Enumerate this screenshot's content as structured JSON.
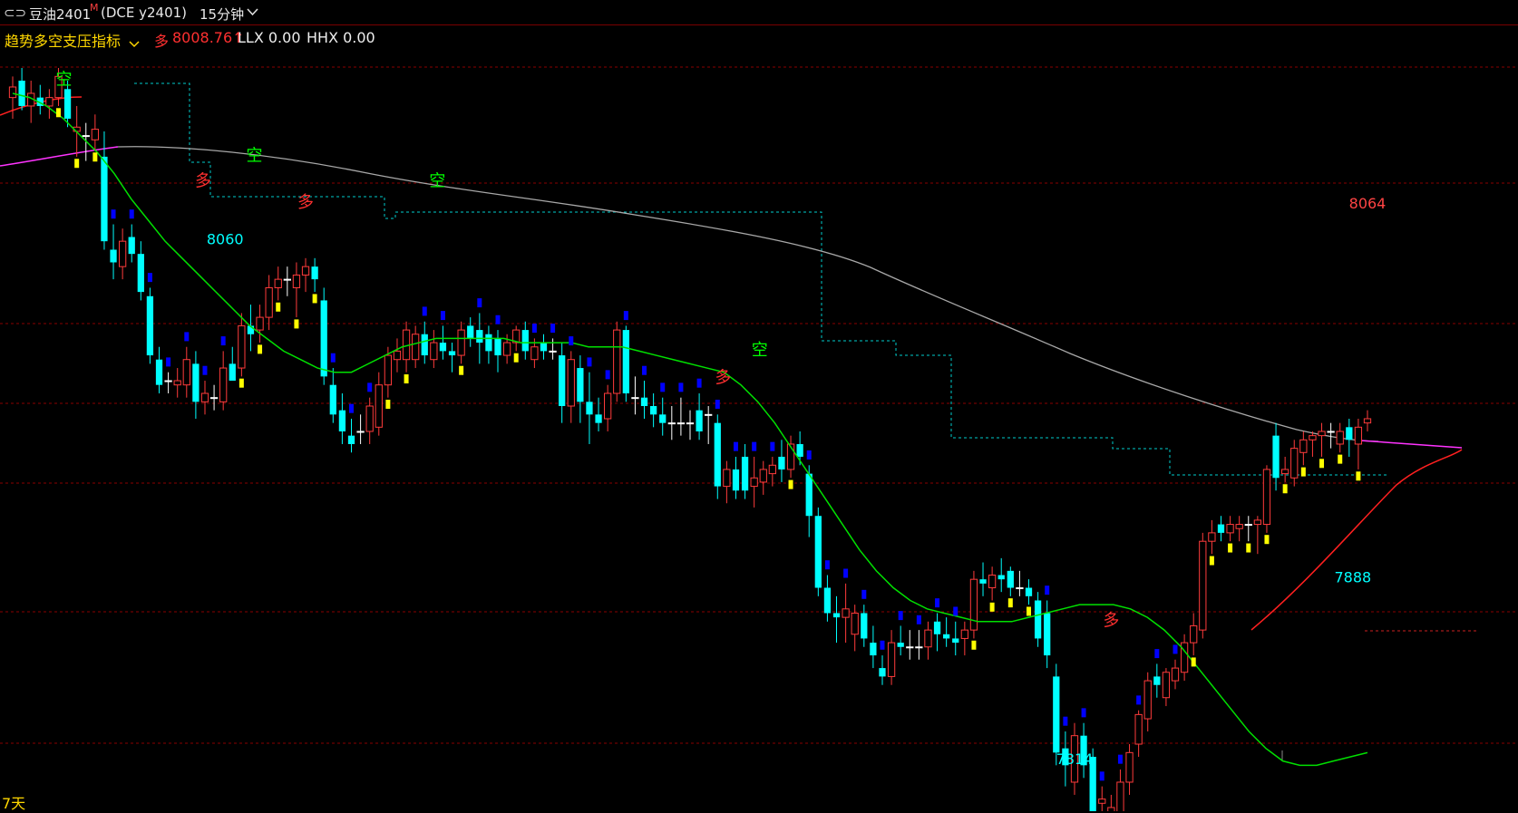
{
  "header": {
    "link_icon": "link-icon",
    "symbol": "豆油2401",
    "sup": "M",
    "code": "(DCE y2401)",
    "period": "15分钟",
    "dropdown_icon": "chevron-down-icon"
  },
  "indicator": {
    "name": "趋势多空支压指标",
    "dropdown_icon": "chevron-down-icon",
    "dir_label": "多",
    "value": "8008.76↑",
    "llx": "LLX 0.00",
    "hhx": "HHX 0.00"
  },
  "bottom_label": "7天",
  "colors": {
    "up": "#ff3b3b",
    "down": "#00ffff",
    "ma_fast": "#00e000",
    "ma_long": "#a8a8a8",
    "ma_magenta": "#ff33ff",
    "support_down": "#0000ff",
    "support_up": "#ffff00",
    "grid": "#8a0000",
    "resistance": "#00cccc"
  },
  "chart_data": {
    "type": "candlestick",
    "ylim": [
      7808,
      8134
    ],
    "annotations": [
      {
        "text": "8060",
        "x": 29,
        "y": 8060,
        "color": "#00ffff",
        "pos": "below"
      },
      {
        "text": "7814",
        "x": 145,
        "y": 7814,
        "color": "#00ffff",
        "pos": "below"
      },
      {
        "text": "8064",
        "x": 185,
        "y": 8064,
        "color": "#ff4444",
        "pos": "above"
      },
      {
        "text": "7888",
        "x": 183,
        "y": 7888,
        "color": "#00ffff",
        "pos": "level"
      }
    ],
    "signals": [
      {
        "text": "空",
        "x": 7,
        "y": 8126,
        "color": "#00ff00"
      },
      {
        "text": "多",
        "x": 26,
        "y": 8078,
        "color": "#ff3030"
      },
      {
        "text": "空",
        "x": 33,
        "y": 8090,
        "color": "#00ff00"
      },
      {
        "text": "多",
        "x": 40,
        "y": 8068,
        "color": "#ff3030"
      },
      {
        "text": "空",
        "x": 58,
        "y": 8078,
        "color": "#00ff00"
      },
      {
        "text": "多",
        "x": 97,
        "y": 7985,
        "color": "#ff3030"
      },
      {
        "text": "空",
        "x": 102,
        "y": 7998,
        "color": "#00ff00"
      },
      {
        "text": "多",
        "x": 150,
        "y": 7870,
        "color": "#ff3030"
      }
    ],
    "candles": [
      {
        "o": 8120,
        "h": 8130,
        "l": 8110,
        "c": 8125
      },
      {
        "o": 8128,
        "h": 8134,
        "l": 8114,
        "c": 8116
      },
      {
        "o": 8116,
        "h": 8128,
        "l": 8108,
        "c": 8122
      },
      {
        "o": 8120,
        "h": 8126,
        "l": 8112,
        "c": 8116
      },
      {
        "o": 8116,
        "h": 8124,
        "l": 8110,
        "c": 8120
      },
      {
        "o": 8120,
        "h": 8134,
        "l": 8116,
        "c": 8130
      },
      {
        "o": 8124,
        "h": 8128,
        "l": 8106,
        "c": 8110
      },
      {
        "o": 8104,
        "h": 8116,
        "l": 8092,
        "c": 8106
      },
      {
        "o": 8102,
        "h": 8108,
        "l": 8090,
        "c": 8102
      },
      {
        "o": 8100,
        "h": 8112,
        "l": 8095,
        "c": 8105
      },
      {
        "o": 8092,
        "h": 8104,
        "l": 8048,
        "c": 8052
      },
      {
        "o": 8048,
        "h": 8060,
        "l": 8034,
        "c": 8042
      },
      {
        "o": 8040,
        "h": 8058,
        "l": 8034,
        "c": 8052
      },
      {
        "o": 8054,
        "h": 8060,
        "l": 8042,
        "c": 8046
      },
      {
        "o": 8046,
        "h": 8052,
        "l": 8024,
        "c": 8028
      },
      {
        "o": 8026,
        "h": 8030,
        "l": 7994,
        "c": 7998
      },
      {
        "o": 7996,
        "h": 8002,
        "l": 7980,
        "c": 7984
      },
      {
        "o": 7986,
        "h": 7990,
        "l": 7980,
        "c": 7986
      },
      {
        "o": 7984,
        "h": 7992,
        "l": 7978,
        "c": 7986
      },
      {
        "o": 7984,
        "h": 8002,
        "l": 7978,
        "c": 7996
      },
      {
        "o": 7994,
        "h": 8000,
        "l": 7968,
        "c": 7976
      },
      {
        "o": 7976,
        "h": 7986,
        "l": 7970,
        "c": 7980
      },
      {
        "o": 7978,
        "h": 7984,
        "l": 7972,
        "c": 7978
      },
      {
        "o": 7976,
        "h": 8000,
        "l": 7972,
        "c": 7992
      },
      {
        "o": 7994,
        "h": 8002,
        "l": 7986,
        "c": 7986
      },
      {
        "o": 7992,
        "h": 8018,
        "l": 7988,
        "c": 8012
      },
      {
        "o": 8012,
        "h": 8022,
        "l": 8000,
        "c": 8008
      },
      {
        "o": 8010,
        "h": 8022,
        "l": 8004,
        "c": 8016
      },
      {
        "o": 8016,
        "h": 8036,
        "l": 8010,
        "c": 8030
      },
      {
        "o": 8030,
        "h": 8040,
        "l": 8024,
        "c": 8034
      },
      {
        "o": 8034,
        "h": 8040,
        "l": 8026,
        "c": 8034
      },
      {
        "o": 8030,
        "h": 8042,
        "l": 8016,
        "c": 8036
      },
      {
        "o": 8036,
        "h": 8044,
        "l": 8028,
        "c": 8040
      },
      {
        "o": 8040,
        "h": 8044,
        "l": 8028,
        "c": 8034
      },
      {
        "o": 8024,
        "h": 8030,
        "l": 7984,
        "c": 7988
      },
      {
        "o": 7984,
        "h": 7992,
        "l": 7966,
        "c": 7970
      },
      {
        "o": 7972,
        "h": 7980,
        "l": 7956,
        "c": 7962
      },
      {
        "o": 7960,
        "h": 7968,
        "l": 7952,
        "c": 7956
      },
      {
        "o": 7962,
        "h": 7970,
        "l": 7956,
        "c": 7962
      },
      {
        "o": 7962,
        "h": 7978,
        "l": 7956,
        "c": 7974
      },
      {
        "o": 7964,
        "h": 7990,
        "l": 7960,
        "c": 7984
      },
      {
        "o": 7984,
        "h": 8002,
        "l": 7978,
        "c": 7998
      },
      {
        "o": 7996,
        "h": 8006,
        "l": 7990,
        "c": 8000
      },
      {
        "o": 7996,
        "h": 8014,
        "l": 7990,
        "c": 8010
      },
      {
        "o": 7996,
        "h": 8012,
        "l": 7992,
        "c": 8008
      },
      {
        "o": 8008,
        "h": 8014,
        "l": 7994,
        "c": 7998
      },
      {
        "o": 7996,
        "h": 8010,
        "l": 7992,
        "c": 8004
      },
      {
        "o": 8004,
        "h": 8012,
        "l": 7996,
        "c": 8000
      },
      {
        "o": 8000,
        "h": 8004,
        "l": 7990,
        "c": 7998
      },
      {
        "o": 7998,
        "h": 8014,
        "l": 7994,
        "c": 8010
      },
      {
        "o": 8012,
        "h": 8016,
        "l": 8002,
        "c": 8006
      },
      {
        "o": 8010,
        "h": 8018,
        "l": 7994,
        "c": 8004
      },
      {
        "o": 8008,
        "h": 8012,
        "l": 7994,
        "c": 8000
      },
      {
        "o": 8006,
        "h": 8010,
        "l": 7990,
        "c": 7998
      },
      {
        "o": 7998,
        "h": 8008,
        "l": 7994,
        "c": 8004
      },
      {
        "o": 8004,
        "h": 8012,
        "l": 8000,
        "c": 8010
      },
      {
        "o": 8010,
        "h": 8014,
        "l": 7996,
        "c": 8000
      },
      {
        "o": 7996,
        "h": 8006,
        "l": 7992,
        "c": 8002
      },
      {
        "o": 8004,
        "h": 8008,
        "l": 7996,
        "c": 8000
      },
      {
        "o": 8000,
        "h": 8006,
        "l": 7996,
        "c": 8000
      },
      {
        "o": 7998,
        "h": 8004,
        "l": 7966,
        "c": 7974
      },
      {
        "o": 7974,
        "h": 8000,
        "l": 7966,
        "c": 7996
      },
      {
        "o": 7992,
        "h": 7998,
        "l": 7966,
        "c": 7976
      },
      {
        "o": 7976,
        "h": 7990,
        "l": 7956,
        "c": 7970
      },
      {
        "o": 7970,
        "h": 7978,
        "l": 7962,
        "c": 7966
      },
      {
        "o": 7968,
        "h": 7984,
        "l": 7962,
        "c": 7980
      },
      {
        "o": 7980,
        "h": 8014,
        "l": 7976,
        "c": 8010
      },
      {
        "o": 8010,
        "h": 8012,
        "l": 7976,
        "c": 7980
      },
      {
        "o": 7978,
        "h": 7988,
        "l": 7970,
        "c": 7978
      },
      {
        "o": 7978,
        "h": 7986,
        "l": 7968,
        "c": 7974
      },
      {
        "o": 7974,
        "h": 7980,
        "l": 7964,
        "c": 7970
      },
      {
        "o": 7970,
        "h": 7978,
        "l": 7960,
        "c": 7966
      },
      {
        "o": 7966,
        "h": 7974,
        "l": 7958,
        "c": 7966
      },
      {
        "o": 7966,
        "h": 7978,
        "l": 7960,
        "c": 7966
      },
      {
        "o": 7966,
        "h": 7972,
        "l": 7958,
        "c": 7966
      },
      {
        "o": 7972,
        "h": 7980,
        "l": 7958,
        "c": 7962
      },
      {
        "o": 7970,
        "h": 7974,
        "l": 7956,
        "c": 7970
      },
      {
        "o": 7966,
        "h": 7970,
        "l": 7930,
        "c": 7936
      },
      {
        "o": 7936,
        "h": 7948,
        "l": 7928,
        "c": 7944
      },
      {
        "o": 7944,
        "h": 7950,
        "l": 7930,
        "c": 7934
      },
      {
        "o": 7950,
        "h": 7956,
        "l": 7930,
        "c": 7934
      },
      {
        "o": 7936,
        "h": 7950,
        "l": 7926,
        "c": 7940
      },
      {
        "o": 7938,
        "h": 7948,
        "l": 7932,
        "c": 7944
      },
      {
        "o": 7942,
        "h": 7950,
        "l": 7936,
        "c": 7946
      },
      {
        "o": 7950,
        "h": 7958,
        "l": 7938,
        "c": 7944
      },
      {
        "o": 7944,
        "h": 7960,
        "l": 7940,
        "c": 7956
      },
      {
        "o": 7956,
        "h": 7962,
        "l": 7946,
        "c": 7950
      },
      {
        "o": 7942,
        "h": 7946,
        "l": 7912,
        "c": 7922
      },
      {
        "o": 7922,
        "h": 7926,
        "l": 7884,
        "c": 7888
      },
      {
        "o": 7888,
        "h": 7894,
        "l": 7872,
        "c": 7876
      },
      {
        "o": 7876,
        "h": 7884,
        "l": 7862,
        "c": 7874
      },
      {
        "o": 7874,
        "h": 7890,
        "l": 7862,
        "c": 7878
      },
      {
        "o": 7866,
        "h": 7880,
        "l": 7858,
        "c": 7876
      },
      {
        "o": 7876,
        "h": 7880,
        "l": 7860,
        "c": 7864
      },
      {
        "o": 7862,
        "h": 7870,
        "l": 7850,
        "c": 7856
      },
      {
        "o": 7850,
        "h": 7856,
        "l": 7842,
        "c": 7846
      },
      {
        "o": 7846,
        "h": 7868,
        "l": 7842,
        "c": 7862
      },
      {
        "o": 7862,
        "h": 7870,
        "l": 7856,
        "c": 7860
      },
      {
        "o": 7860,
        "h": 7868,
        "l": 7854,
        "c": 7860
      },
      {
        "o": 7860,
        "h": 7868,
        "l": 7854,
        "c": 7860
      },
      {
        "o": 7860,
        "h": 7872,
        "l": 7854,
        "c": 7868
      },
      {
        "o": 7872,
        "h": 7876,
        "l": 7858,
        "c": 7866
      },
      {
        "o": 7866,
        "h": 7874,
        "l": 7860,
        "c": 7864
      },
      {
        "o": 7864,
        "h": 7872,
        "l": 7856,
        "c": 7862
      },
      {
        "o": 7864,
        "h": 7872,
        "l": 7856,
        "c": 7868
      },
      {
        "o": 7868,
        "h": 7896,
        "l": 7864,
        "c": 7892
      },
      {
        "o": 7892,
        "h": 7900,
        "l": 7884,
        "c": 7890
      },
      {
        "o": 7888,
        "h": 7898,
        "l": 7882,
        "c": 7894
      },
      {
        "o": 7894,
        "h": 7902,
        "l": 7886,
        "c": 7892
      },
      {
        "o": 7896,
        "h": 7898,
        "l": 7884,
        "c": 7888
      },
      {
        "o": 7888,
        "h": 7896,
        "l": 7884,
        "c": 7888
      },
      {
        "o": 7888,
        "h": 7892,
        "l": 7880,
        "c": 7884
      },
      {
        "o": 7882,
        "h": 7886,
        "l": 7860,
        "c": 7864
      },
      {
        "o": 7876,
        "h": 7882,
        "l": 7850,
        "c": 7856
      },
      {
        "o": 7846,
        "h": 7852,
        "l": 7804,
        "c": 7810
      },
      {
        "o": 7812,
        "h": 7820,
        "l": 7794,
        "c": 7804
      },
      {
        "o": 7796,
        "h": 7824,
        "l": 7790,
        "c": 7818
      },
      {
        "o": 7818,
        "h": 7824,
        "l": 7798,
        "c": 7804
      },
      {
        "o": 7808,
        "h": 7812,
        "l": 7774,
        "c": 7780
      },
      {
        "o": 7786,
        "h": 7794,
        "l": 7778,
        "c": 7788
      },
      {
        "o": 7782,
        "h": 7790,
        "l": 7770,
        "c": 7784
      },
      {
        "o": 7782,
        "h": 7802,
        "l": 7778,
        "c": 7796
      },
      {
        "o": 7796,
        "h": 7814,
        "l": 7790,
        "c": 7810
      },
      {
        "o": 7814,
        "h": 7830,
        "l": 7808,
        "c": 7828
      },
      {
        "o": 7826,
        "h": 7848,
        "l": 7820,
        "c": 7844
      },
      {
        "o": 7846,
        "h": 7852,
        "l": 7836,
        "c": 7842
      },
      {
        "o": 7836,
        "h": 7850,
        "l": 7832,
        "c": 7848
      },
      {
        "o": 7844,
        "h": 7854,
        "l": 7840,
        "c": 7850
      },
      {
        "o": 7848,
        "h": 7866,
        "l": 7844,
        "c": 7862
      },
      {
        "o": 7862,
        "h": 7876,
        "l": 7856,
        "c": 7870
      },
      {
        "o": 7868,
        "h": 7914,
        "l": 7864,
        "c": 7910
      },
      {
        "o": 7910,
        "h": 7920,
        "l": 7904,
        "c": 7914
      },
      {
        "o": 7918,
        "h": 7922,
        "l": 7910,
        "c": 7914
      },
      {
        "o": 7914,
        "h": 7922,
        "l": 7910,
        "c": 7918
      },
      {
        "o": 7916,
        "h": 7922,
        "l": 7910,
        "c": 7918
      },
      {
        "o": 7918,
        "h": 7922,
        "l": 7910,
        "c": 7918
      },
      {
        "o": 7918,
        "h": 7922,
        "l": 7904,
        "c": 7920
      },
      {
        "o": 7918,
        "h": 7946,
        "l": 7914,
        "c": 7944
      },
      {
        "o": 7960,
        "h": 7966,
        "l": 7934,
        "c": 7940
      },
      {
        "o": 7942,
        "h": 7950,
        "l": 7938,
        "c": 7944
      },
      {
        "o": 7940,
        "h": 7958,
        "l": 7936,
        "c": 7954
      },
      {
        "o": 7952,
        "h": 7962,
        "l": 7946,
        "c": 7958
      },
      {
        "o": 7958,
        "h": 7962,
        "l": 7950,
        "c": 7960
      },
      {
        "o": 7960,
        "h": 7966,
        "l": 7950,
        "c": 7962
      },
      {
        "o": 7962,
        "h": 7966,
        "l": 7954,
        "c": 7962
      },
      {
        "o": 7956,
        "h": 7966,
        "l": 7952,
        "c": 7962
      },
      {
        "o": 7964,
        "h": 7968,
        "l": 7950,
        "c": 7958
      },
      {
        "o": 7956,
        "h": 7968,
        "l": 7944,
        "c": 7964
      },
      {
        "o": 7966,
        "h": 7972,
        "l": 7962,
        "c": 7968
      }
    ],
    "ma_fast": [
      8122,
      8120,
      8116,
      8110,
      8102,
      8094,
      8084,
      8072,
      8062,
      8052,
      8044,
      8036,
      8028,
      8020,
      8012,
      8006,
      8000,
      7996,
      7992,
      7990,
      7990,
      7994,
      7998,
      8002,
      8004,
      8006,
      8006,
      8006,
      8006,
      8006,
      8004,
      8004,
      8004,
      8004,
      8002,
      8002,
      8002,
      8000,
      7998,
      7996,
      7994,
      7992,
      7990,
      7984,
      7976,
      7966,
      7954,
      7942,
      7930,
      7918,
      7906,
      7896,
      7888,
      7882,
      7878,
      7876,
      7874,
      7872,
      7872,
      7872,
      7874,
      7876,
      7878,
      7880,
      7880,
      7880,
      7878,
      7874,
      7868,
      7860,
      7850,
      7840,
      7830,
      7820,
      7812,
      7806,
      7804,
      7804,
      7806,
      7808,
      7810
    ],
    "ma_fast_x": [
      0,
      2,
      4,
      6,
      8,
      10,
      12,
      14,
      16,
      18,
      20,
      22,
      24,
      26,
      28,
      30,
      32,
      34,
      36,
      38,
      40,
      42,
      44,
      46,
      48,
      50,
      52,
      54,
      56,
      58,
      60,
      62,
      64,
      66,
      68,
      70,
      72,
      74,
      76,
      78,
      80,
      82,
      84,
      86,
      88,
      90,
      92,
      94,
      96,
      98,
      100,
      102,
      104,
      106,
      108,
      110,
      112,
      114,
      116,
      118,
      120,
      122,
      124,
      126,
      128,
      130,
      132,
      134,
      136,
      138,
      140,
      142,
      144,
      146,
      148,
      150,
      152,
      154,
      156,
      158,
      160
    ]
  }
}
